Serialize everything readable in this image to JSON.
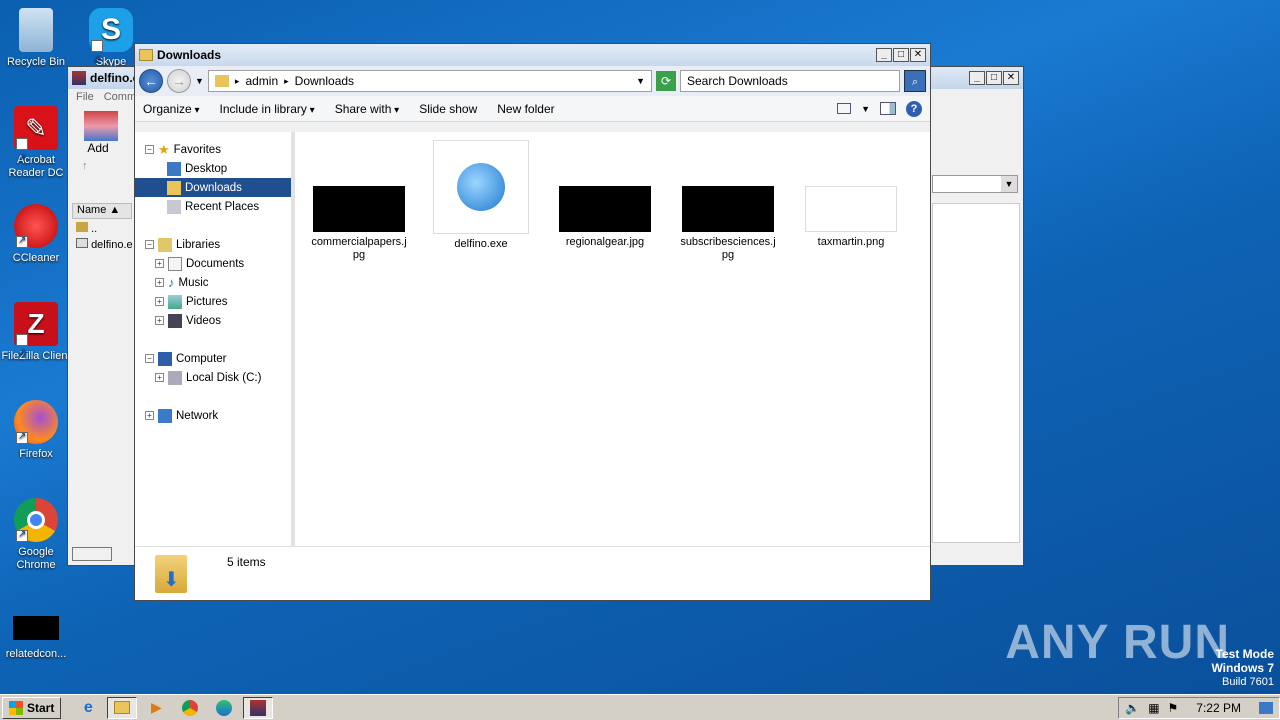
{
  "desktop": {
    "icons": [
      {
        "label": "Recycle Bin",
        "icon": "recycle-bin-icon"
      },
      {
        "label": "Skype",
        "icon": "skype-icon"
      },
      {
        "label": "Acrobat Reader DC",
        "icon": "acrobat-icon"
      },
      {
        "label": "CCleaner",
        "icon": "ccleaner-icon"
      },
      {
        "label": "FileZilla Client",
        "icon": "filezilla-icon"
      },
      {
        "label": "Firefox",
        "icon": "firefox-icon"
      },
      {
        "label": "Google Chrome",
        "icon": "chrome-icon"
      },
      {
        "label": "relatedcon...",
        "icon": "image-file-icon"
      }
    ],
    "watermark": "ANY RUN",
    "test_mode": {
      "line1": "Test Mode",
      "line2": "Windows 7",
      "line3": "Build 7601"
    }
  },
  "winrar": {
    "title": "delfino.e",
    "menu": [
      "File",
      "Comm"
    ],
    "toolbar_add": "Add",
    "column_name": "Name",
    "rows": [
      "..",
      "delfino.e"
    ]
  },
  "explorer": {
    "title": "Downloads",
    "breadcrumb": [
      "admin",
      "Downloads"
    ],
    "search_placeholder": "Search Downloads",
    "commands": [
      "Organize",
      "Include in library",
      "Share with",
      "Slide show",
      "New folder"
    ],
    "nav": {
      "favorites": "Favorites",
      "fav_items": [
        "Desktop",
        "Downloads",
        "Recent Places"
      ],
      "libraries": "Libraries",
      "lib_items": [
        "Documents",
        "Music",
        "Pictures",
        "Videos"
      ],
      "computer": "Computer",
      "comp_items": [
        "Local Disk (C:)"
      ],
      "network": "Network"
    },
    "files": [
      {
        "name": "commercialpapers.j pg",
        "kind": "dark"
      },
      {
        "name": "delfino.exe",
        "kind": "exe"
      },
      {
        "name": "regionalgear.jpg",
        "kind": "dark"
      },
      {
        "name": "subscribesciences.j pg",
        "kind": "dark"
      },
      {
        "name": "taxmartin.png",
        "kind": "light"
      }
    ],
    "status": "5 items"
  },
  "taskbar": {
    "start": "Start",
    "clock": "7:22 PM"
  }
}
